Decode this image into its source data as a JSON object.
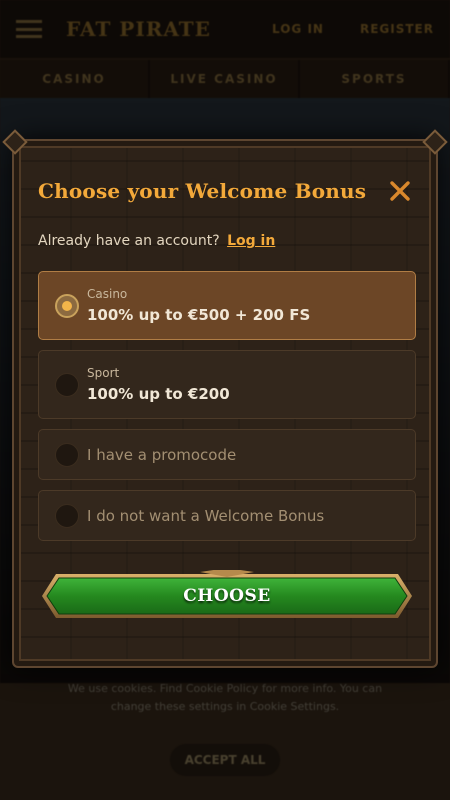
{
  "background": {
    "logo": "FAT PIRATE",
    "login": "LOG IN",
    "register": "REGISTER",
    "nav": [
      "CASINO",
      "LIVE CASINO",
      "SPORTS"
    ],
    "cookie_text": "We use cookies. Find Cookie Policy for more info. You can change these settings in Cookie Settings.",
    "cookie_button": "ACCEPT ALL"
  },
  "modal": {
    "title": "Choose your Welcome Bonus",
    "account_prompt": "Already have an account?",
    "login_link": "Log in",
    "options": [
      {
        "category": "Casino",
        "value": "100% up to €500 + 200 FS",
        "selected": true
      },
      {
        "category": "Sport",
        "value": "100% up to €200",
        "selected": false
      },
      {
        "label": "I have a promocode",
        "selected": false
      },
      {
        "label": "I do not want a Welcome Bonus",
        "selected": false
      }
    ],
    "choose_button": "CHOOSE"
  },
  "colors": {
    "accent": "#f3a93a",
    "selected_option": "#6c4626",
    "button_green": "#2e9a2a"
  }
}
